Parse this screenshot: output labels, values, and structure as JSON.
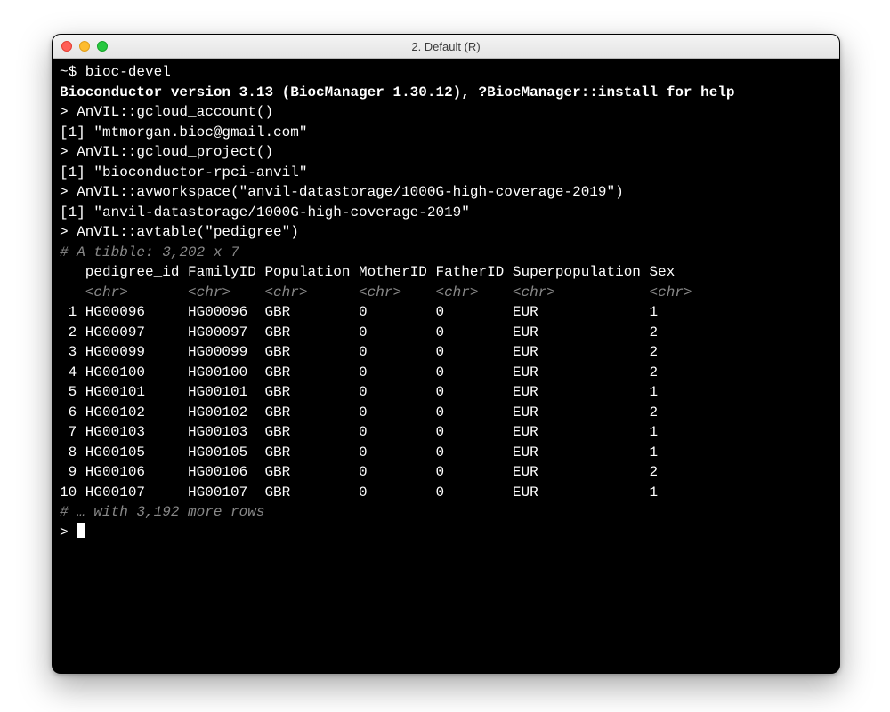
{
  "window": {
    "title": "2. Default (R)"
  },
  "colors": {
    "dim": "#888888",
    "fg": "#ffffff",
    "bg": "#000000"
  },
  "term": {
    "prompt_cmd": "~$ bioc-devel",
    "bioc_line": "Bioconductor version 3.13 (BiocManager 1.30.12), ?BiocManager::install for help",
    "l1_cmd": "> AnVIL::gcloud_account()",
    "l1_out": "[1] \"mtmorgan.bioc@gmail.com\"",
    "l2_cmd": "> AnVIL::gcloud_project()",
    "l2_out": "[1] \"bioconductor-rpci-anvil\"",
    "l3_cmd": "> AnVIL::avworkspace(\"anvil-datastorage/1000G-high-coverage-2019\")",
    "l3_out": "[1] \"anvil-datastorage/1000G-high-coverage-2019\"",
    "l4_cmd": "> AnVIL::avtable(\"pedigree\")",
    "tibble_header": "# A tibble: 3,202 x 7",
    "col_header": "   pedigree_id FamilyID Population MotherID FatherID Superpopulation Sex",
    "type_row": "   <chr>       <chr>    <chr>      <chr>    <chr>    <chr>           <chr>",
    "rows": [
      " 1 HG00096     HG00096  GBR        0        0        EUR             1",
      " 2 HG00097     HG00097  GBR        0        0        EUR             2",
      " 3 HG00099     HG00099  GBR        0        0        EUR             2",
      " 4 HG00100     HG00100  GBR        0        0        EUR             2",
      " 5 HG00101     HG00101  GBR        0        0        EUR             1",
      " 6 HG00102     HG00102  GBR        0        0        EUR             2",
      " 7 HG00103     HG00103  GBR        0        0        EUR             1",
      " 8 HG00105     HG00105  GBR        0        0        EUR             1",
      " 9 HG00106     HG00106  GBR        0        0        EUR             2",
      "10 HG00107     HG00107  GBR        0        0        EUR             1"
    ],
    "more_rows": "# … with 3,192 more rows",
    "final_prompt": "> "
  }
}
